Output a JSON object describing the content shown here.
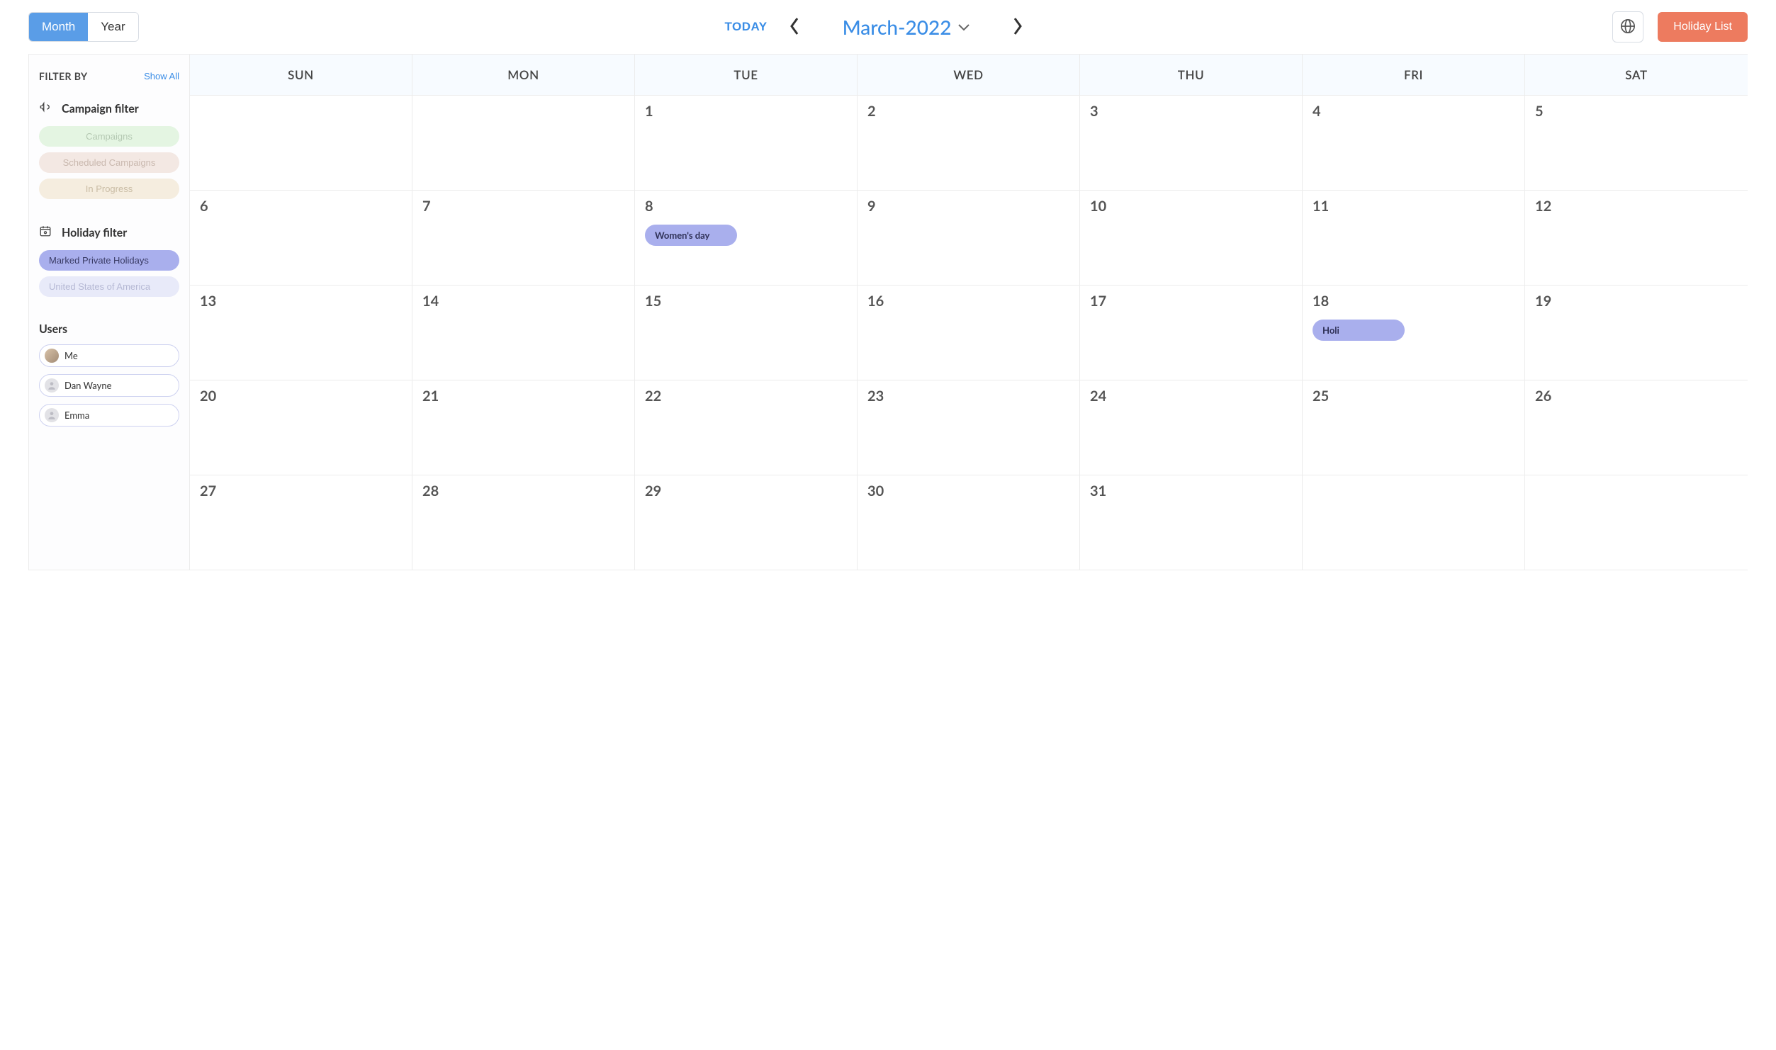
{
  "header": {
    "view_month": "Month",
    "view_year": "Year",
    "today": "TODAY",
    "month_label": "March-2022",
    "holiday_list": "Holiday List"
  },
  "sidebar": {
    "filter_by": "FILTER BY",
    "show_all": "Show All",
    "campaign_filter_title": "Campaign filter",
    "campaign_pills": {
      "campaigns": "Campaigns",
      "scheduled": "Scheduled Campaigns",
      "inprogress": "In Progress"
    },
    "holiday_filter_title": "Holiday filter",
    "holiday_pills": {
      "marked": "Marked Private Holidays",
      "usa": "United States of America"
    },
    "users_title": "Users",
    "users": [
      {
        "name": "Me"
      },
      {
        "name": "Dan Wayne"
      },
      {
        "name": "Emma"
      }
    ]
  },
  "calendar": {
    "dow": [
      "SUN",
      "MON",
      "TUE",
      "WED",
      "THU",
      "FRI",
      "SAT"
    ],
    "weeks": [
      [
        {
          "num": ""
        },
        {
          "num": ""
        },
        {
          "num": "1"
        },
        {
          "num": "2"
        },
        {
          "num": "3"
        },
        {
          "num": "4"
        },
        {
          "num": "5"
        }
      ],
      [
        {
          "num": "6"
        },
        {
          "num": "7"
        },
        {
          "num": "8",
          "event": "Women's day"
        },
        {
          "num": "9"
        },
        {
          "num": "10"
        },
        {
          "num": "11"
        },
        {
          "num": "12"
        }
      ],
      [
        {
          "num": "13"
        },
        {
          "num": "14"
        },
        {
          "num": "15"
        },
        {
          "num": "16"
        },
        {
          "num": "17"
        },
        {
          "num": "18",
          "event": "Holi"
        },
        {
          "num": "19"
        }
      ],
      [
        {
          "num": "20"
        },
        {
          "num": "21"
        },
        {
          "num": "22"
        },
        {
          "num": "23"
        },
        {
          "num": "24"
        },
        {
          "num": "25"
        },
        {
          "num": "26"
        }
      ],
      [
        {
          "num": "27"
        },
        {
          "num": "28"
        },
        {
          "num": "29"
        },
        {
          "num": "30"
        },
        {
          "num": "31"
        },
        {
          "num": ""
        },
        {
          "num": ""
        }
      ]
    ]
  }
}
